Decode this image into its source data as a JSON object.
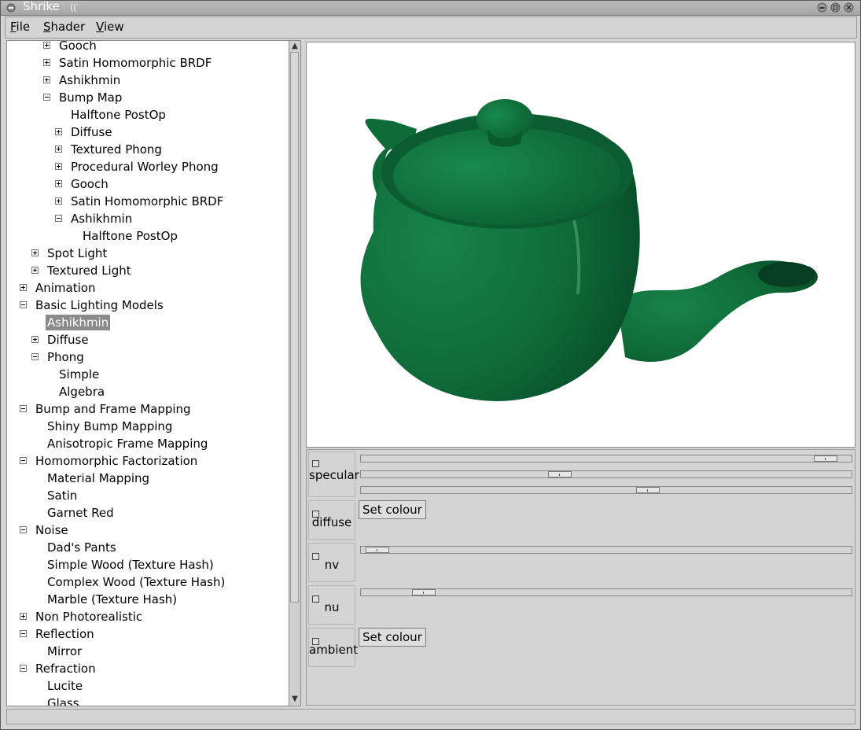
{
  "window": {
    "title": "Shrike"
  },
  "menu": [
    {
      "mnemonic": "F",
      "rest": "ile"
    },
    {
      "mnemonic": "S",
      "rest": "hader"
    },
    {
      "mnemonic": "V",
      "rest": "iew"
    }
  ],
  "tree": [
    {
      "label": "Gooch",
      "level": 2,
      "expander": "plus"
    },
    {
      "label": "Satin Homomorphic BRDF",
      "level": 2,
      "expander": "plus"
    },
    {
      "label": "Ashikhmin",
      "level": 2,
      "expander": "plus"
    },
    {
      "label": "Bump Map",
      "level": 2,
      "expander": "minus"
    },
    {
      "label": "Halftone PostOp",
      "level": 3,
      "expander": "none"
    },
    {
      "label": "Diffuse",
      "level": 3,
      "expander": "plus"
    },
    {
      "label": "Textured Phong",
      "level": 3,
      "expander": "plus"
    },
    {
      "label": "Procedural Worley Phong",
      "level": 3,
      "expander": "plus"
    },
    {
      "label": "Gooch",
      "level": 3,
      "expander": "plus"
    },
    {
      "label": "Satin Homomorphic BRDF",
      "level": 3,
      "expander": "plus"
    },
    {
      "label": "Ashikhmin",
      "level": 3,
      "expander": "minus"
    },
    {
      "label": "Halftone PostOp",
      "level": 4,
      "expander": "none"
    },
    {
      "label": "Spot Light",
      "level": 1,
      "expander": "plus"
    },
    {
      "label": "Textured Light",
      "level": 1,
      "expander": "plus"
    },
    {
      "label": "Animation",
      "level": 0,
      "expander": "plus"
    },
    {
      "label": "Basic Lighting Models",
      "level": 0,
      "expander": "minus"
    },
    {
      "label": "Ashikhmin",
      "level": 1,
      "expander": "none",
      "selected": true
    },
    {
      "label": "Diffuse",
      "level": 1,
      "expander": "plus"
    },
    {
      "label": "Phong",
      "level": 1,
      "expander": "minus"
    },
    {
      "label": "Simple",
      "level": 2,
      "expander": "none"
    },
    {
      "label": "Algebra",
      "level": 2,
      "expander": "none"
    },
    {
      "label": "Bump and Frame Mapping",
      "level": 0,
      "expander": "minus"
    },
    {
      "label": "Shiny Bump Mapping",
      "level": 1,
      "expander": "none"
    },
    {
      "label": "Anisotropic Frame Mapping",
      "level": 1,
      "expander": "none"
    },
    {
      "label": "Homomorphic Factorization",
      "level": 0,
      "expander": "minus"
    },
    {
      "label": "Material Mapping",
      "level": 1,
      "expander": "none"
    },
    {
      "label": "Satin",
      "level": 1,
      "expander": "none"
    },
    {
      "label": "Garnet Red",
      "level": 1,
      "expander": "none"
    },
    {
      "label": "Noise",
      "level": 0,
      "expander": "minus"
    },
    {
      "label": "Dad's Pants",
      "level": 1,
      "expander": "none"
    },
    {
      "label": "Simple Wood (Texture Hash)",
      "level": 1,
      "expander": "none"
    },
    {
      "label": "Complex Wood (Texture Hash)",
      "level": 1,
      "expander": "none"
    },
    {
      "label": "Marble (Texture Hash)",
      "level": 1,
      "expander": "none"
    },
    {
      "label": "Non Photorealistic",
      "level": 0,
      "expander": "plus"
    },
    {
      "label": "Reflection",
      "level": 0,
      "expander": "minus"
    },
    {
      "label": "Mirror",
      "level": 1,
      "expander": "none"
    },
    {
      "label": "Refraction",
      "level": 0,
      "expander": "minus"
    },
    {
      "label": "Lucite",
      "level": 1,
      "expander": "none"
    },
    {
      "label": "Glass",
      "level": 1,
      "expander": "none"
    }
  ],
  "params": [
    {
      "name": "specular",
      "type": "sliders",
      "values": [
        0.97,
        0.4,
        0.59
      ]
    },
    {
      "name": "diffuse",
      "type": "colour",
      "button": "Set colour"
    },
    {
      "name": "nv",
      "type": "sliders",
      "values": [
        0.01
      ]
    },
    {
      "name": "nu",
      "type": "sliders",
      "values": [
        0.11
      ]
    },
    {
      "name": "ambient",
      "type": "colour",
      "button": "Set colour"
    }
  ],
  "colors": {
    "teapot": "#0f6b38",
    "selection": "#8a8a8a"
  },
  "icons": {
    "up": "scroll-up-arrow-icon",
    "down": "scroll-down-arrow-icon"
  }
}
